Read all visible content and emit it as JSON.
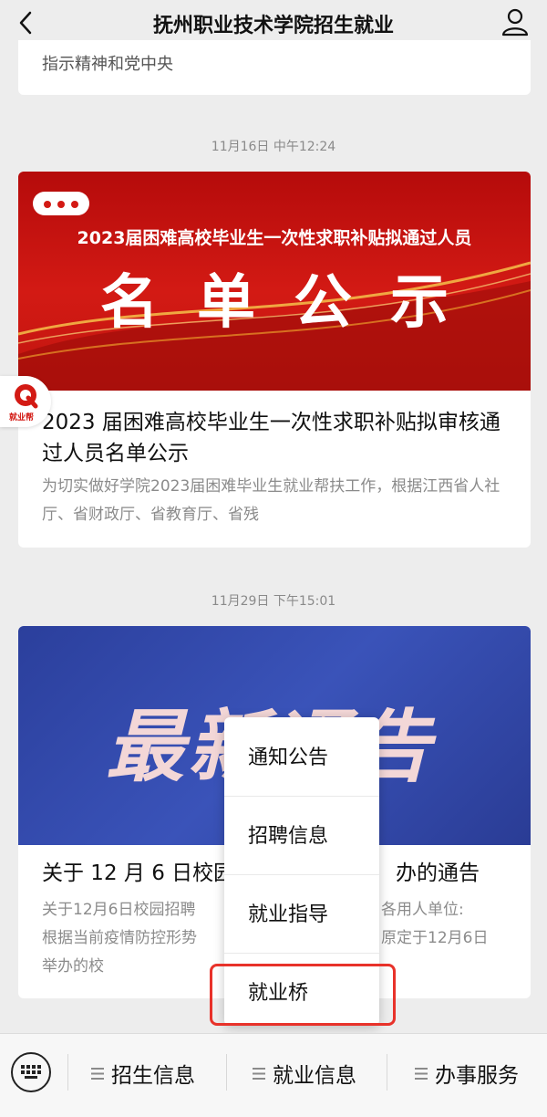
{
  "header": {
    "title": "抚州职业技术学院招生就业"
  },
  "messages": [
    {
      "excerpt": "指示精神和党中央"
    },
    {
      "time": "11月16日 中午12:24",
      "banner_subtitle": "2023届困难高校毕业生一次性求职补贴拟通过人员",
      "banner_title": "名单公示",
      "title": "2023 届困难高校毕业生一次性求职补贴拟审核通过人员名单公示",
      "description": "为切实做好学院2023届困难毕业生就业帮扶工作，根据江西省人社厅、省财政厅、省教育厅、省残"
    },
    {
      "time": "11月29日 下午15:01",
      "banner_title": "最新通告",
      "title": "关于 12 月 6 日校园",
      "title_end": "办的通告",
      "description_l1": "关于12月6日校园招聘",
      "description_l1_end": "各用人单位:",
      "description_l2": "根据当前疫情防控形势",
      "description_l2_end": "原定于12月6日",
      "description_l3": "举办的校"
    }
  ],
  "floating_badge": {
    "label": "就业帮"
  },
  "popup_menu": {
    "items": [
      "通知公告",
      "招聘信息",
      "就业指导",
      "就业桥"
    ],
    "highlighted_index": 3
  },
  "bottom_menu": {
    "tabs": [
      "招生信息",
      "就业信息",
      "办事服务"
    ]
  },
  "colors": {
    "banner1": "#c0150f",
    "banner2": "#3a53b9",
    "highlight": "#e8322a"
  }
}
